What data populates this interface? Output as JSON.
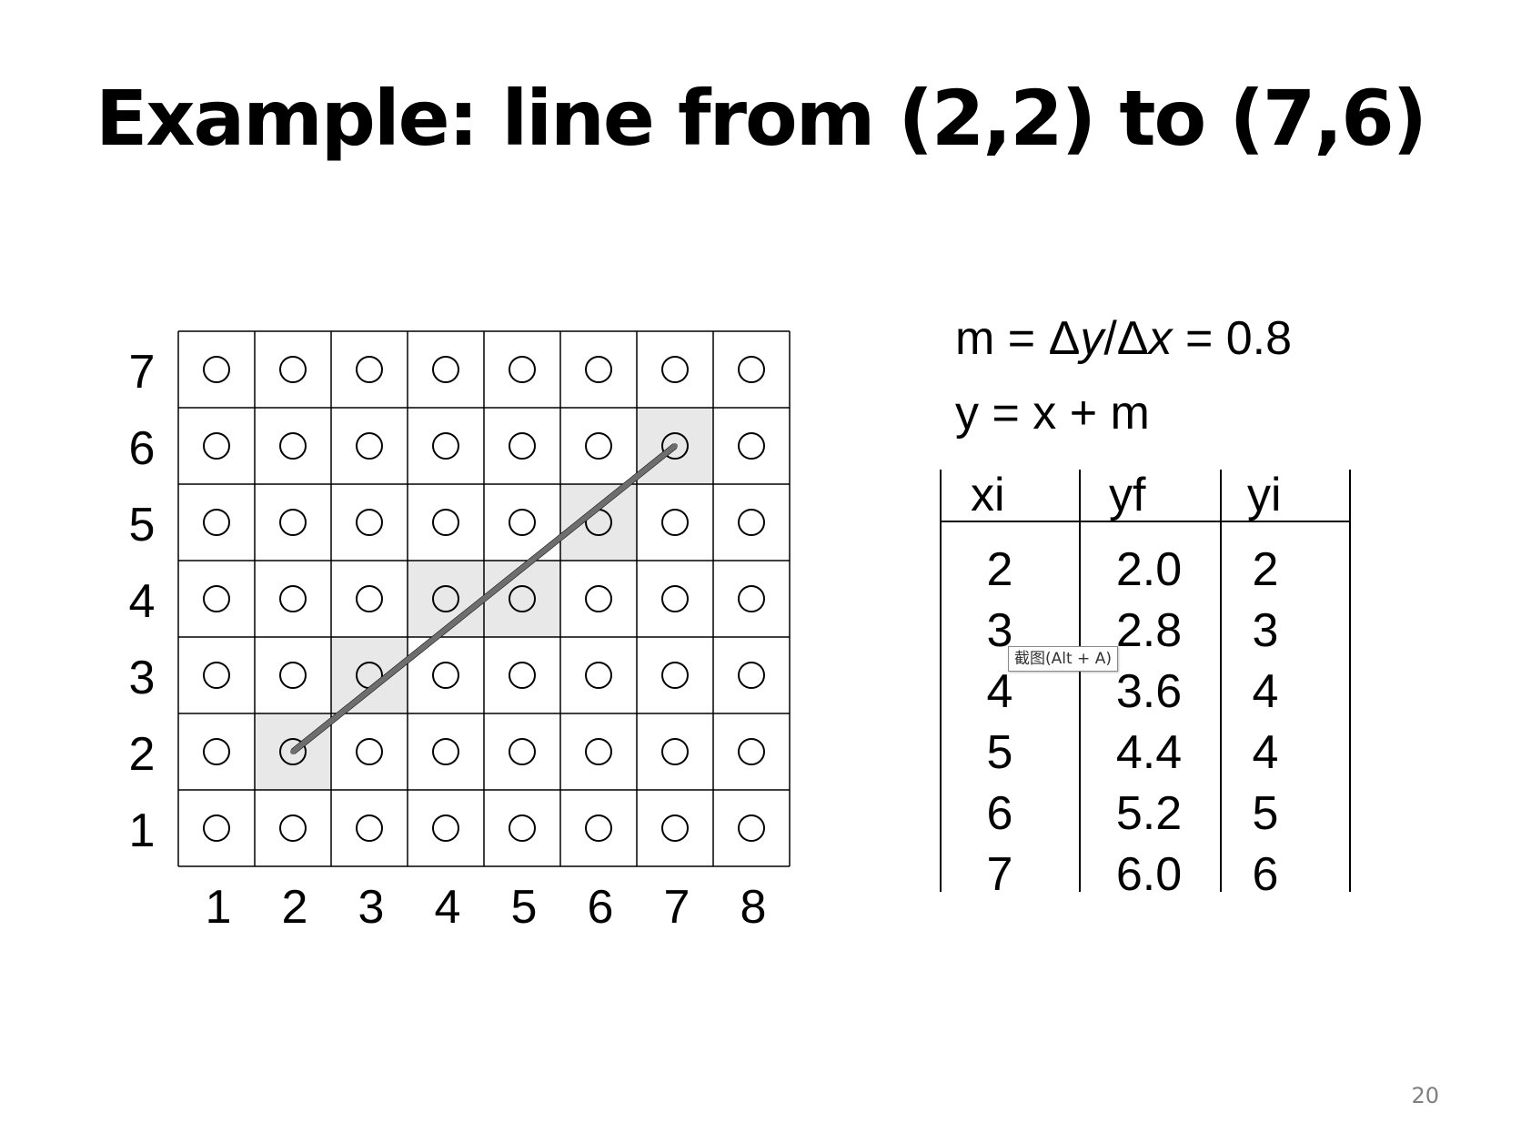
{
  "slide": {
    "title": "Example: line from (2,2) to (7,6)",
    "page_number": "20"
  },
  "formulas": {
    "slope": {
      "prefix": "m = Δ",
      "dy": "y",
      "slash": "/Δ",
      "dx": "x",
      "suffix": " = 0.8"
    },
    "update": "y = x + m"
  },
  "table": {
    "headers": [
      "xi",
      "yf",
      "yi"
    ],
    "rows": [
      [
        "2",
        "2.0",
        "2"
      ],
      [
        "3",
        "2.8",
        "3"
      ],
      [
        "4",
        "3.6",
        "4"
      ],
      [
        "5",
        "4.4",
        "4"
      ],
      [
        "6",
        "5.2",
        "5"
      ],
      [
        "7",
        "6.0",
        "6"
      ]
    ]
  },
  "grid": {
    "x_labels": [
      "1",
      "2",
      "3",
      "4",
      "5",
      "6",
      "7",
      "8"
    ],
    "y_labels": [
      "1",
      "2",
      "3",
      "4",
      "5",
      "6",
      "7"
    ],
    "highlighted_pixels": [
      [
        2,
        2
      ],
      [
        3,
        3
      ],
      [
        4,
        4
      ],
      [
        5,
        4
      ],
      [
        6,
        5
      ],
      [
        7,
        6
      ]
    ],
    "line": {
      "from": [
        2,
        2
      ],
      "to": [
        7,
        6
      ]
    },
    "colors": {
      "highlight": "#e8e8e8",
      "line_ideal": "#000000",
      "line_overlay": "#6e6e6e",
      "grid": "#000000"
    }
  },
  "tooltip": {
    "text": "截图(Alt + A)"
  }
}
